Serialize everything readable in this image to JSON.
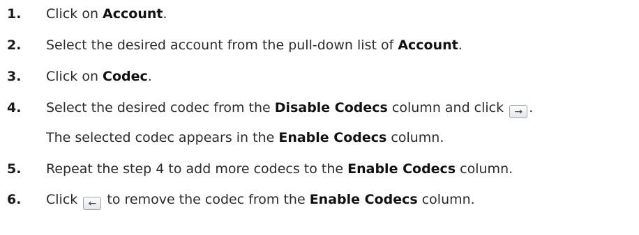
{
  "steps": [
    {
      "num": "1.",
      "pre": "Click on ",
      "b1": "Account",
      "post": "."
    },
    {
      "num": "2.",
      "pre": "Select the desired account from the pull-down list of ",
      "b1": "Account",
      "post": "."
    },
    {
      "num": "3.",
      "pre": "Click on ",
      "b1": "Codec",
      "post": "."
    },
    {
      "num": "4.",
      "pre": "Select the desired codec from the ",
      "b1": "Disable Codecs",
      "mid": " column and click ",
      "btn": "→",
      "post": "."
    },
    {
      "pre": "The selected codec appears in the ",
      "b1": "Enable Codecs",
      "post": " column."
    },
    {
      "num": "5.",
      "pre": "Repeat the step 4 to add more codecs to the ",
      "b1": "Enable Codecs",
      "post": " column."
    },
    {
      "num": "6.",
      "pre": "Click ",
      "btn": "←",
      "mid": " to remove the codec from the ",
      "b1": "Enable Codecs",
      "post": " column."
    }
  ],
  "icons": {
    "move_right": "arrow-right-icon",
    "move_left": "arrow-left-icon"
  }
}
